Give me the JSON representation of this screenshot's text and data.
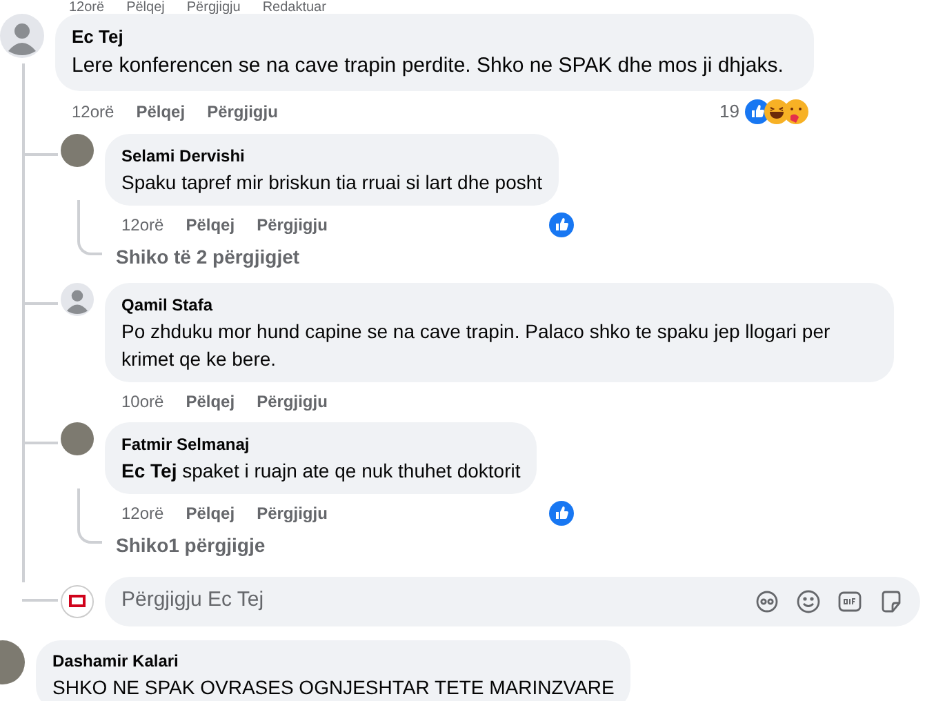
{
  "previous_actions": [
    "12orë",
    "Pëlqej",
    "Përgjigju",
    "Redaktuar"
  ],
  "comment": {
    "author": "Ec Tej",
    "text": "Lere konferencen se na cave trapin perdite. Shko ne SPAK dhe mos ji dhjaks.",
    "time": "12orë",
    "actions": [
      "Pëlqej",
      "Përgjigju"
    ],
    "reaction_count": "19",
    "reactions": [
      {
        "kind": "like"
      },
      {
        "kind": "haha"
      },
      {
        "kind": "care"
      }
    ],
    "replies": [
      {
        "author": "Selami Dervishi",
        "kind": "photo",
        "text": "Spaku tapref mir briskun tia rruai si lart dhe posht",
        "time": "12orë",
        "actions": [
          "Pëlqej",
          "Përgjigju"
        ],
        "liked": true,
        "more_replies": "Shiko të 2 përgjigjet"
      },
      {
        "author": "Qamil Stafa",
        "kind": "default",
        "text": "Po zhduku mor hund capine se na cave trapin. Palaco shko te spaku jep llogari per krimet qe ke bere.",
        "time": "10orë",
        "actions": [
          "Pëlqej",
          "Përgjigju"
        ],
        "liked": false
      },
      {
        "author": "Fatmir Selmanaj",
        "kind": "photo",
        "text": "**Ec Tej** spaket i ruajn ate qe nuk thuhet doktorit",
        "time": "12orë",
        "actions": [
          "Pëlqej",
          "Përgjigju"
        ],
        "liked": true,
        "more_replies": "Shiko1 përgjigje"
      }
    ],
    "reply_box": {
      "placeholder": "Përgjigju Ec Tej"
    }
  },
  "next_comment": {
    "author": "Dashamir Kalari",
    "text": "SHKO NE SPAK OVRASES OGNJESHTAR TETE MARINZVARE"
  }
}
